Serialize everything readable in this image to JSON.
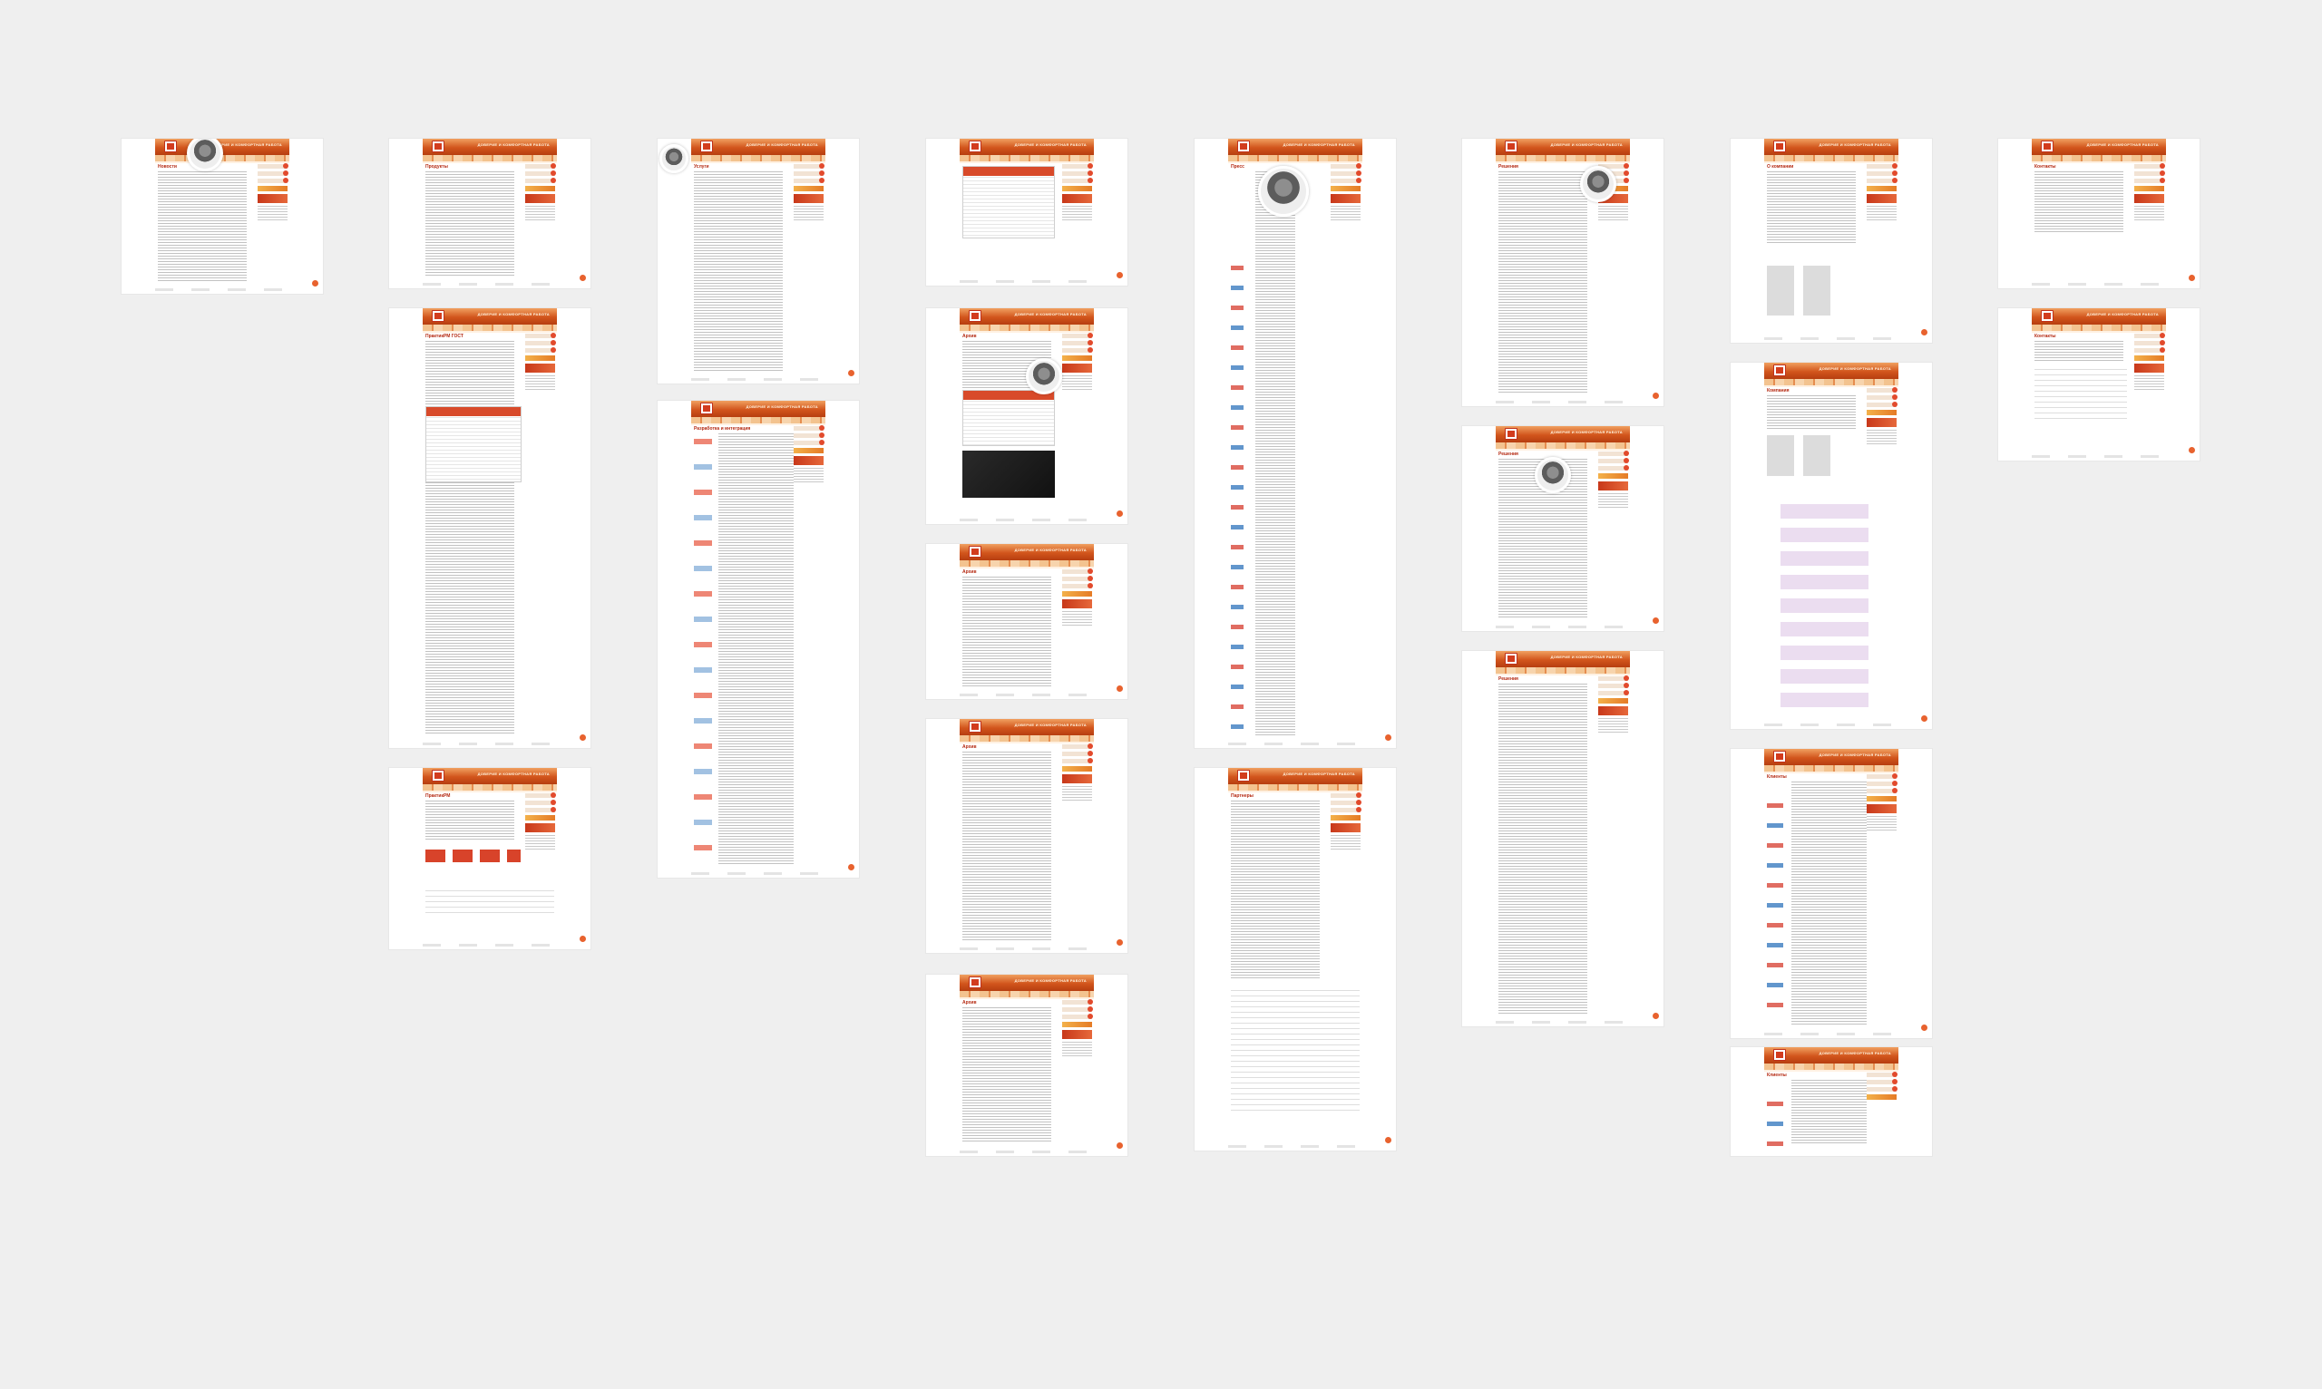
{
  "site": {
    "slogan": "ДОВЕРИЕ И КОМФОРТНАЯ РАБОТА",
    "colors": {
      "header": "#d2551c",
      "accent": "#b52a12",
      "canvas": "#efefef"
    }
  },
  "pages": [
    {
      "id": "p1",
      "title": "Новости"
    },
    {
      "id": "p2",
      "title": "Продукты"
    },
    {
      "id": "p3",
      "title": "ПрактикРМ ГОСТ"
    },
    {
      "id": "p4",
      "title": "ПрактикРМ"
    },
    {
      "id": "p5",
      "title": "Услуги"
    },
    {
      "id": "p6",
      "title": "Разработка и интеграция"
    },
    {
      "id": "p7",
      "title": ""
    },
    {
      "id": "p8",
      "title": "Архив"
    },
    {
      "id": "p9",
      "title": "Архив"
    },
    {
      "id": "p10",
      "title": "Архив"
    },
    {
      "id": "p11",
      "title": "Архив"
    },
    {
      "id": "p12",
      "title": "Пресс"
    },
    {
      "id": "p13",
      "title": "Партнеры"
    },
    {
      "id": "p14",
      "title": "Решения"
    },
    {
      "id": "p15",
      "title": "Решения"
    },
    {
      "id": "p16",
      "title": "Решения"
    },
    {
      "id": "p17",
      "title": "О компании"
    },
    {
      "id": "p18",
      "title": "Компания"
    },
    {
      "id": "p19",
      "title": "Клиенты"
    },
    {
      "id": "p20",
      "title": "Клиенты"
    },
    {
      "id": "p21",
      "title": "Контакты"
    },
    {
      "id": "p22",
      "title": "Контакты"
    }
  ]
}
